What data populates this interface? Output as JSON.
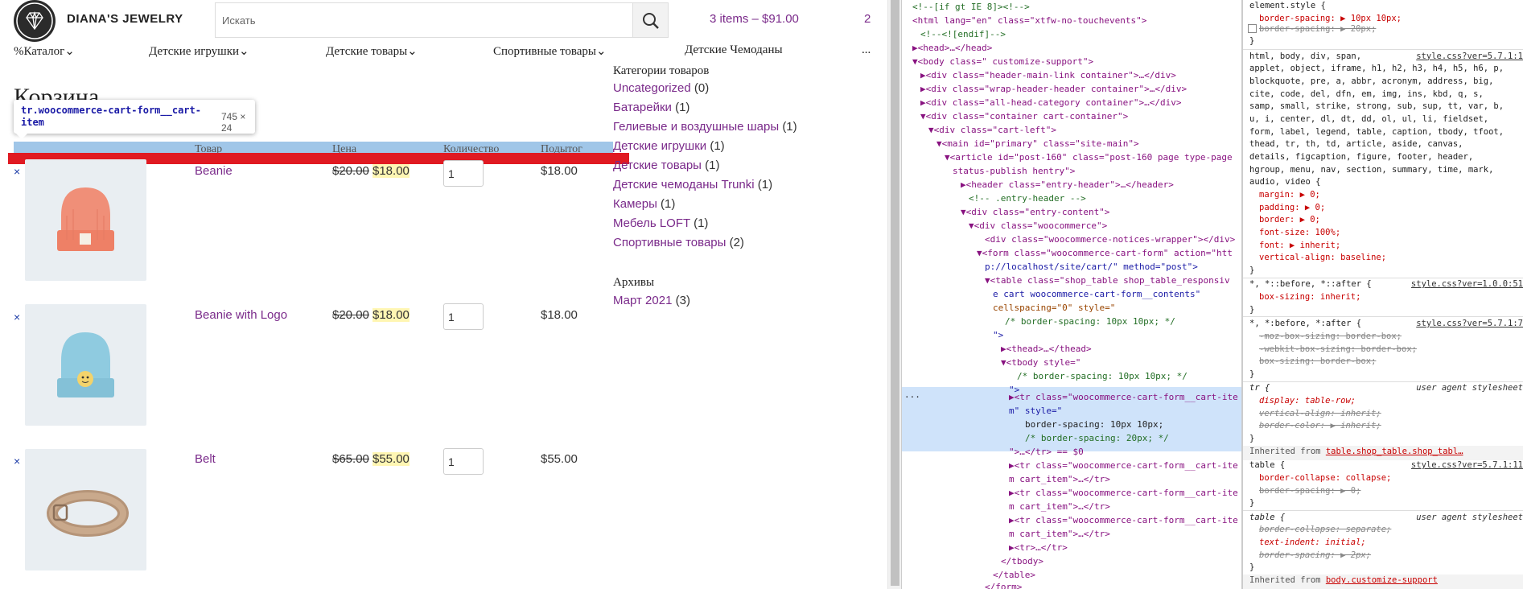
{
  "header": {
    "site_title": "DIANA'S JEWELRY",
    "search_placeholder": "Искать",
    "cart_summary": "3 items – $91.00",
    "cart_count": "2"
  },
  "nav": {
    "items": [
      "%Каталог",
      "Детские игрушки",
      "Детские товары",
      "Спортивные товары",
      "Детские Чемоданы",
      "..."
    ]
  },
  "page": {
    "heading": "Корзина",
    "table_headers": [
      "Товар",
      "Цена",
      "Количество",
      "Подытог"
    ]
  },
  "tooltip": {
    "selector": "tr.woocommerce-cart-form__cart-item",
    "size": "745 × 24"
  },
  "cart_items": [
    {
      "remove": "×",
      "name": "Beanie",
      "old_price": "$20.00",
      "price": "$18.00",
      "qty": "1",
      "subtotal": "$18.00",
      "image": "orange-beanie"
    },
    {
      "remove": "×",
      "name": "Beanie with Logo",
      "old_price": "$20.00",
      "price": "$18.00",
      "qty": "1",
      "subtotal": "$18.00",
      "image": "blue-beanie-with-logo"
    },
    {
      "remove": "×",
      "name": "Belt",
      "old_price": "$65.00",
      "price": "$55.00",
      "qty": "1",
      "subtotal": "$55.00",
      "image": "leather-belt"
    }
  ],
  "sidebar": {
    "categories_title": "Категории товаров",
    "categories": [
      {
        "name": "Uncategorized",
        "count": "(0)"
      },
      {
        "name": "Батарейки",
        "count": "(1)"
      },
      {
        "name": "Гелиевые и воздушные шары",
        "count": "(1)"
      },
      {
        "name": "Детские игрушки",
        "count": "(1)"
      },
      {
        "name": "Детские товары",
        "count": "(1)"
      },
      {
        "name": "Детские чемоданы Trunki",
        "count": "(1)"
      },
      {
        "name": "Камеры",
        "count": "(1)"
      },
      {
        "name": "Мебель LOFT",
        "count": "(1)"
      },
      {
        "name": "Спортивные товары",
        "count": "(2)"
      }
    ],
    "archives_title": "Архивы",
    "archives": [
      {
        "name": "Март 2021",
        "count": "(3)"
      }
    ]
  },
  "devtools": {
    "elements": [
      "<!--[if gt IE 8]><!-->",
      "<html lang=\"en\" class=\"xtfw-no-touchevents\">",
      "<!--<![endif]-->",
      "▶<head>…</head>",
      "▼<body class=\" customize-support\">",
      "▶<div class=\"header-main-link container\">…</div>",
      "▶<div class=\"wrap-header-header container\">…</div>",
      "▶<div class=\"all-head-category container\">…</div>",
      "▼<div class=\"container cart-container\">",
      "▼<div class=\"cart-left\">",
      "▼<main id=\"primary\" class=\"site-main\">",
      "▼<article id=\"post-160\" class=\"post-160 page type-page",
      "status-publish hentry\">",
      "▶<header class=\"entry-header\">…</header>",
      "<!-- .entry-header -->",
      "▼<div class=\"entry-content\">",
      "▼<div class=\"woocommerce\">",
      "<div class=\"woocommerce-notices-wrapper\"></div>",
      "▼<form class=\"woocommerce-cart-form\" action=\"htt",
      "p://localhost/site/cart/\" method=\"post\">",
      "▼<table class=\"shop_table shop_table_responsiv",
      "e cart woocommerce-cart-form__contents\"",
      "cellspacing=\"0\" style=\"",
      "/* border-spacing: 10px 10px; */",
      "\">",
      "▶<thead>…</thead>",
      "▼<tbody style=\"",
      "/* border-spacing: 10px 10px; */",
      "\">",
      "▶<tr class=\"woocommerce-cart-form__cart-ite",
      "m\" style=\"",
      "border-spacing: 10px 10px;",
      "/* border-spacing: 20px; */",
      "\">…</tr> == $0",
      "▶<tr class=\"woocommerce-cart-form__cart-ite",
      "m cart_item\">…</tr>",
      "▶<tr class=\"woocommerce-cart-form__cart-ite",
      "m cart_item\">…</tr>",
      "▶<tr class=\"woocommerce-cart-form__cart-ite",
      "m cart_item\">…</tr>",
      "▶<tr>…</tr>",
      "</tbody>",
      "</table>",
      "</form>"
    ],
    "styles": {
      "element_style_title": "element.style {",
      "element_style_props": [
        "border-spacing: ▶ 10px 10px;",
        "border-spacing: ▶ 20px;"
      ],
      "reset_selector": "html, body, div, span,",
      "reset_src": "style.css?ver=5.7.1:1",
      "reset_lines": [
        "applet, object, iframe, h1, h2, h3, h4, h5, h6, p,",
        "blockquote, pre, a, abbr, acronym, address, big,",
        "cite, code, del, dfn, em, img, ins, kbd, q, s,",
        "samp, small, strike, strong, sub, sup, tt, var, b,",
        "u, i, center, dl, dt, dd, ol, ul, li, fieldset,",
        "form, label, legend, table, caption, tbody, tfoot,",
        "thead, tr, th, td, article, aside, canvas,",
        "details, figcaption, figure, footer, header,",
        "hgroup, menu, nav, section, summary, time, mark,",
        "audio, video {"
      ],
      "reset_props": [
        "margin: ▶ 0;",
        "padding: ▶ 0;",
        "border: ▶ 0;",
        "font-size: 100%;",
        "font: ▶ inherit;",
        "vertical-align: baseline;"
      ],
      "bs1_selector": "*, *::before, *::after {",
      "bs1_src": "style.css?ver=1.0.0:51",
      "bs1_props": [
        "box-sizing: inherit;"
      ],
      "bs2_selector": "*, *:before, *:after {",
      "bs2_src": "style.css?ver=5.7.1:7",
      "bs2_props": [
        "-moz-box-sizing: border-box;",
        "-webkit-box-sizing: border-box;",
        "box-sizing: border-box;"
      ],
      "tr_selector": "tr {",
      "ua_label": "user agent stylesheet",
      "tr_props": [
        "display: table-row;",
        "vertical-align: inherit;",
        "border-color: ▶ inherit;"
      ],
      "inherited1": "Inherited from",
      "inherited1_target": "table.shop_table.shop_tabl…",
      "table1_selector": "table {",
      "table1_src": "style.css?ver=5.7.1:11",
      "table1_props": [
        "border-collapse: collapse;",
        "border-spacing: ▶ 0;"
      ],
      "table2_selector": "table {",
      "table2_props": [
        "border-collapse: separate;",
        "text-indent: initial;",
        "border-spacing: ▶ 2px;"
      ],
      "inherited2": "Inherited from",
      "inherited2_target": "body.customize-support"
    }
  }
}
